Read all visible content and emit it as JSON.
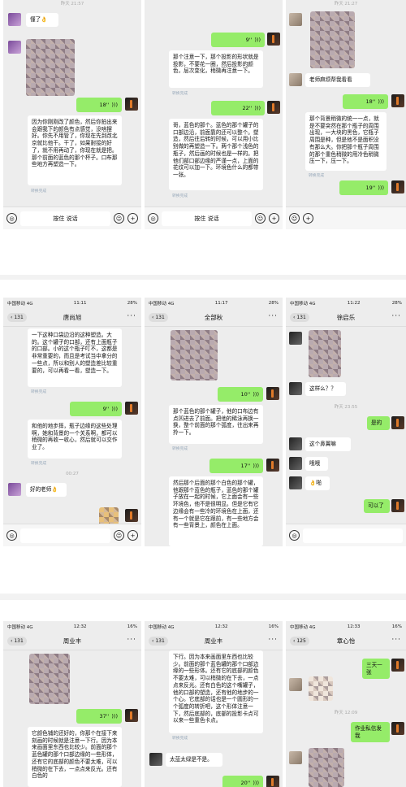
{
  "row1": {
    "p1": {
      "time_top": "昨天 21:57",
      "msg1": "懂了👌",
      "voice1": "18''",
      "long": "因为你刚刚改了颜色，然后你拍出来会跟我下的颜色有点感觉，没啥摆好。你先不用管了，你现在先到改北京就比他干。干了，如果耐接的好了，就不用再动了，你现在就是把。那个前面的蓝色的那个杯子。口布那些地方再塑造一下。",
      "read": "转换完成",
      "input": "按住 说话"
    },
    "p2": {
      "voice1": "9''",
      "b1": "那个注意一下，那个投影的形状就是投影，不要花一圈，然后投影的颜色，层次变化，稍微再注意一下。",
      "read1": "转换完成",
      "voice2": "22''",
      "b2": "哥，蓝色的那个。蓝色的那个罐子的口部边沿，前面靠的还可以整个。塑造，然后往后转的时候，可以用小比别做的再塑造一下。两个那个浅色的瓶子，然后画的时候也是一样的。把他们部口部边缘的严谨一点，上面的花纹可以加一下。环境色什么的都带一张。",
      "read2": "转换完成",
      "input": "按住 说话"
    },
    "p3": {
      "time_top": "昨天 21:27",
      "msg1": "老师麻烦帮我看看",
      "voice1": "18''",
      "b1": "那个背景稍微的统一一点，就是不要突然在那个瓶子的周围出现，一大块的黑色，它瓶子周围是种，但是他不是面积没有那么大。你把那个瓶子周围的那个重色稍微的用冷色稍微压一下，压一下。",
      "read1": "转换完成",
      "voice2": "19''"
    }
  },
  "row2": {
    "p1": {
      "status_left": "中国移动 4G",
      "status_time": "11:11",
      "status_right": "28%",
      "back": "131",
      "title": "唐尚旭",
      "b1": "一下这种口袋边沿的这种塑造。大的。这个罐子的口部，还有上面瓶子的口部。小的这个瓶子叮不，这都是非常重要的，而且是考试当中拿分的一些点，所以和别人的塑造差比较重要的，可以再看一看，塑造一下。",
      "read1": "转换完成",
      "voice1": "9''",
      "b2": "和他的地步摔，瓶子边缘的这些处理啊，她和背景的一个关系啊，都可以稍微的再收一收心，然后就可以交作业了。",
      "read2": "转换完成",
      "time2": "00:27",
      "msg": "好的老师👌",
      "input": ""
    },
    "p2": {
      "status_left": "中国移动 4G",
      "status_time": "11:17",
      "status_right": "28%",
      "back": "131",
      "title": "全部秋",
      "voice1": "10''",
      "b1": "那个蓝色的那个罐子，他的口布边有点凹进去了前面。把他的稀泳再换一换，整个前面的那个弧度，往出来再拎一下。",
      "read1": "转换完成",
      "voice2": "17''",
      "b2": "然后那个后面的那个白色的那个罐，他跟那个蓝色的瓶子，蓝色的那个罐子放在一起的时候，它上面会有一些环境色，他不是很明显。但是它有它边缘会有一些冷的环境色在上面，还有一个就是它在跟前，有一些地方会有一些背景上，颜色在上面。"
    },
    "p3": {
      "status_left": "中国移动 4G",
      "status_time": "11:22",
      "status_right": "28%",
      "back": "131",
      "title": "徐启乐",
      "m1": "这样么？？",
      "time1": "昨天 23:55",
      "m2": "是的",
      "m3": "这个鼻翼嘛",
      "m4": "哦哦",
      "m5": "👌啪",
      "m6": "可以了"
    }
  },
  "row3": {
    "p1": {
      "status_left": "中国移动 4G",
      "status_time": "12:32",
      "status_right": "16%",
      "back": "131",
      "title": "周业丰",
      "voice1": "37''",
      "b1": "它颜色铺的还好的，你那个在接下来刻画的时候就是注意一下行。因为本来画面里东西也比较少。前面的那个蓝色罐的那个口部边缘的一些形体，还有它的底部的颜色不要太难，可以稍微的在下去，一点点来反光。还有白色的"
    },
    "p2": {
      "status_left": "中国移动 4G",
      "status_time": "12:32",
      "status_right": "16%",
      "back": "131",
      "title": "周业丰",
      "b1": "下行。因为本来画面里东西也比较少。前面的那个蓝色罐的那个口部边缘的一些形体。还有它的底部的颜色不要太难，可以稍微的在下去，一点点来反光。还有白色的这个嘴罐子，他的口部的塑造，还有他的地步的一个心。它底部的话也是一个圆形的一个弧度的转折吧，这个形体注意一下，然后底部的，底部的投影卡点可以来一些重色卡点。",
      "read1": "转换完成",
      "msg": "太蓝太绿是不是。",
      "voice1": "20''"
    },
    "p3": {
      "status_left": "中国移动 4G",
      "status_time": "12:33",
      "status_right": "16%",
      "back": "125",
      "title": "章心怡",
      "m1": "三天一张",
      "time1": "昨天 12:09",
      "m2": "作业私信发我"
    }
  },
  "icons": {
    "voice_wave": ")))",
    "mic": "◎",
    "smile": "☺",
    "plus": "+",
    "back_arrow": "‹",
    "more": "···"
  }
}
